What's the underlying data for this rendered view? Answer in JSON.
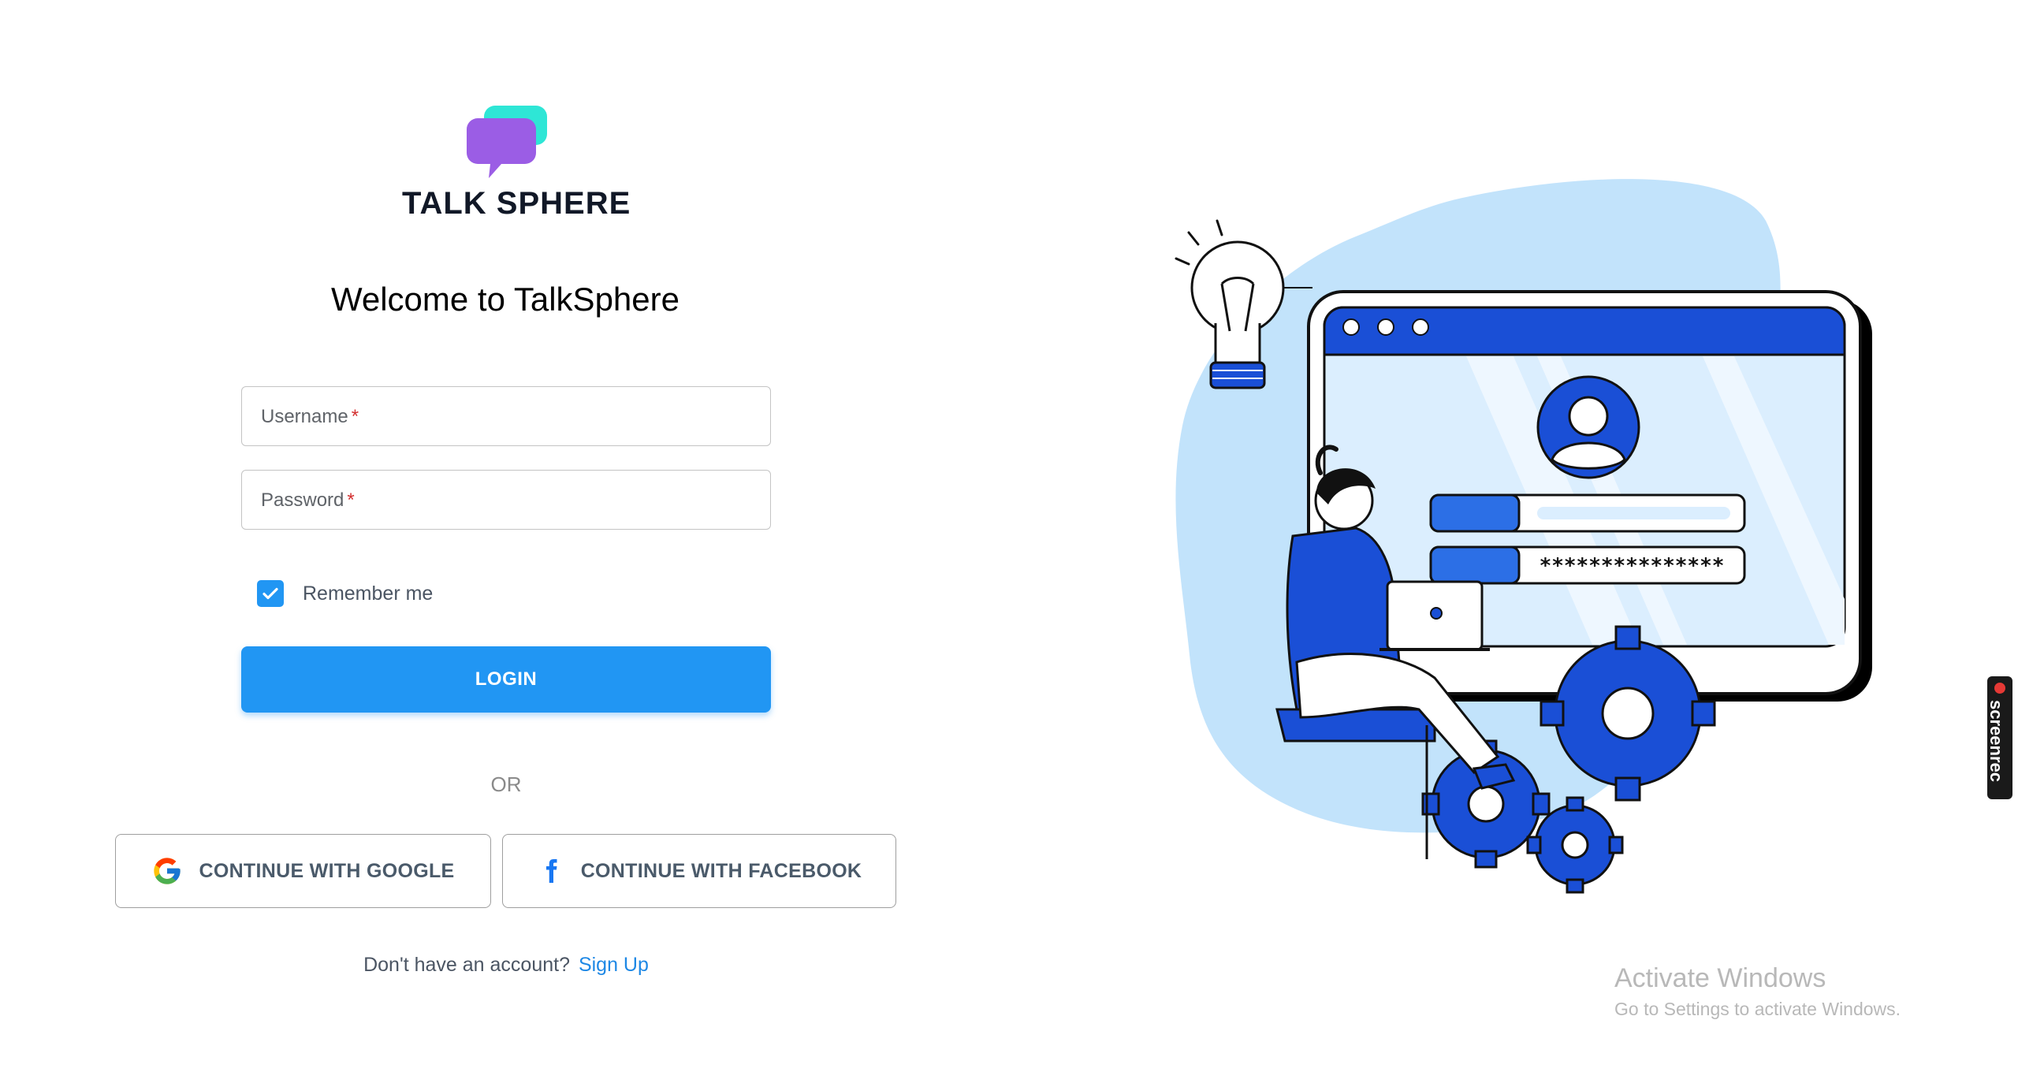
{
  "brand": {
    "name": "TALK SPHERE",
    "colors": {
      "bubble_front": "#9b5de5",
      "bubble_back": "#2ee6d6"
    }
  },
  "welcome_title": "Welcome to TalkSphere",
  "form": {
    "username": {
      "label": "Username",
      "required_mark": "*",
      "value": ""
    },
    "password": {
      "label": "Password",
      "required_mark": "*",
      "value": ""
    },
    "remember_me": {
      "label": "Remember me",
      "checked": true
    },
    "login_label": "LOGIN",
    "accent_color": "#2196f3"
  },
  "divider_text": "OR",
  "social": {
    "google": {
      "label": "CONTINUE WITH GOOGLE",
      "icon": "google-icon"
    },
    "facebook": {
      "label": "CONTINUE WITH FACEBOOK",
      "icon": "facebook-icon"
    }
  },
  "signup": {
    "prompt": "Don't have an account?",
    "link_label": "Sign Up"
  },
  "illustration": {
    "password_mask": "***************"
  },
  "overlays": {
    "activate_title": "Activate Windows",
    "activate_subtitle": "Go to Settings to activate Windows.",
    "screenrec_label": "screenrec"
  }
}
